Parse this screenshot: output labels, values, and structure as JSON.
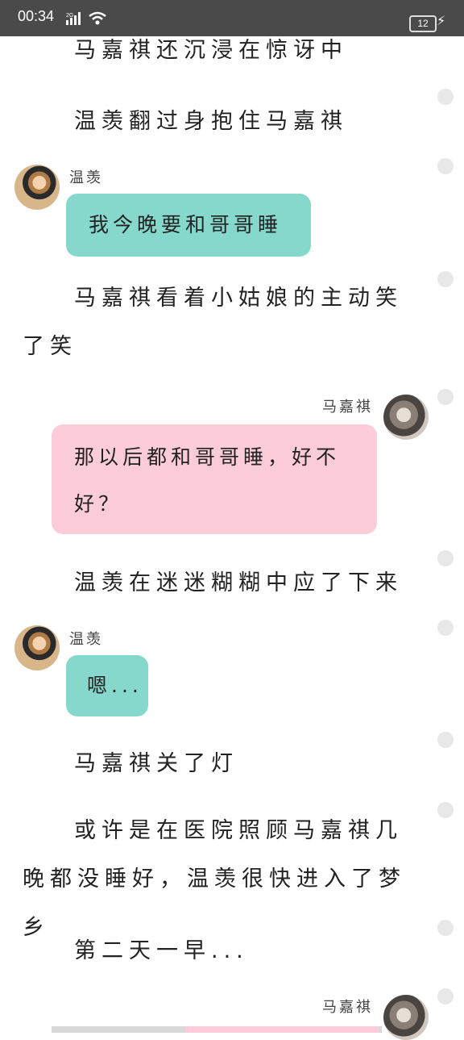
{
  "status_bar": {
    "time": "00:34",
    "network": "2G",
    "battery": "12"
  },
  "story": {
    "narration_1": "马嘉祺还沉浸在惊讶中",
    "narration_2": "温羡翻过身抱住马嘉祺",
    "msg_1": {
      "speaker": "温羡",
      "text": "我今晚要和哥哥睡"
    },
    "narration_3": "马嘉祺看着小姑娘的主动笑了笑",
    "msg_2": {
      "speaker": "马嘉祺",
      "text": "那以后都和哥哥睡，好不好？"
    },
    "narration_4": "温羡在迷迷糊糊中应了下来",
    "msg_3": {
      "speaker": "温羡",
      "text": "嗯..."
    },
    "narration_5": "马嘉祺关了灯",
    "narration_6": "或许是在医院照顾马嘉祺几晚都没睡好，温羡很快进入了梦乡",
    "narration_7": "第二天一早...",
    "msg_4": {
      "speaker": "马嘉祺"
    }
  },
  "colors": {
    "green_bubble": "#86d8cd",
    "pink_bubble": "#fccdd9",
    "status_bar": "#4a4a4a"
  }
}
